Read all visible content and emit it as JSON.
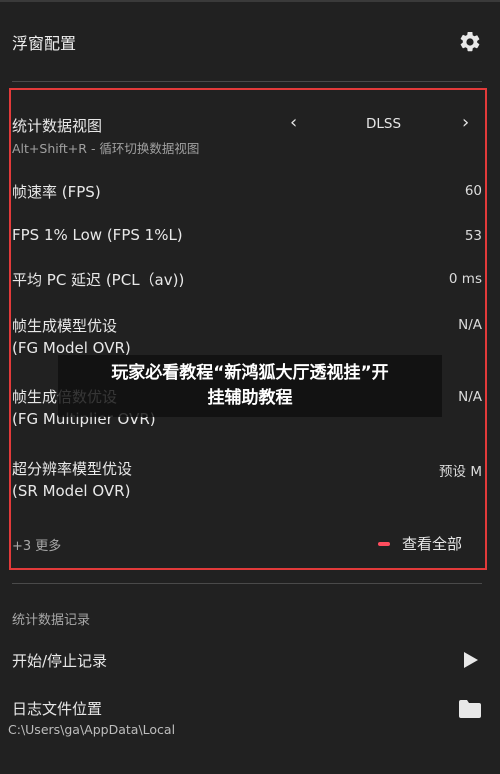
{
  "header": {
    "title": "浮窗配置"
  },
  "stats": {
    "view_title": "统计数据视图",
    "view_shortcut": "Alt+Shift+R - 循环切换数据视图",
    "view_name": "DLSS",
    "rows": [
      {
        "label": "帧速率 (FPS)",
        "value": "60"
      },
      {
        "label": "FPS 1% Low (FPS 1%L)",
        "value": "53"
      },
      {
        "label": "平均 PC 延迟 (PCL（av))",
        "value": "0 ms"
      },
      {
        "label": "帧生成模型优设",
        "sub": "(FG Model OVR)",
        "value": "N/A"
      },
      {
        "label": "帧生成倍数优设",
        "sub": "(FG Multiplier OVR)",
        "value": "N/A"
      },
      {
        "label": "超分辨率模型优设",
        "sub": "(SR Model OVR)",
        "value": "预设 M"
      }
    ],
    "more": "+3 更多",
    "view_all": "查看全部"
  },
  "overlay": {
    "line1": "玩家必看教程“新鸿狐大厅透视挂”开",
    "line2": "挂辅助教程"
  },
  "records": {
    "section_title": "统计数据记录",
    "start_stop": "开始/停止记录",
    "log_location": "日志文件位置",
    "log_path": "C:\\Users\\ga\\AppData\\Local"
  },
  "colors": {
    "accent": "#e23a3a",
    "dash": "#ff4d5e",
    "background": "#212121"
  },
  "icons": {
    "settings": "gear-icon",
    "prev": "chevron-left-icon",
    "next": "chevron-right-icon",
    "start": "play-icon",
    "folder": "folder-icon"
  }
}
